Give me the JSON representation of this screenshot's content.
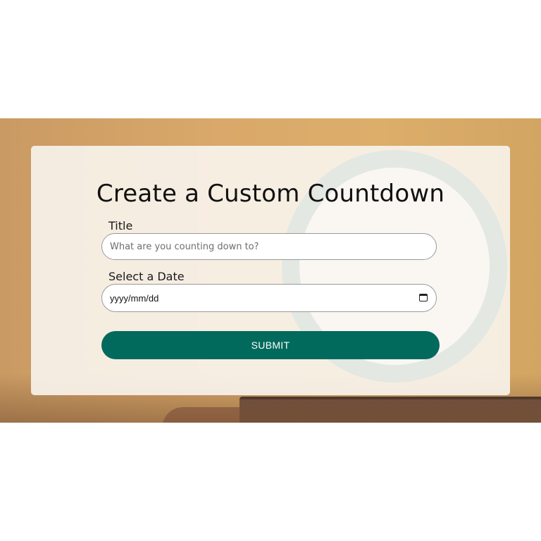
{
  "form": {
    "heading": "Create a Custom Countdown",
    "title_label": "Title",
    "title_placeholder": "What are you counting down to?",
    "date_label": "Select a Date",
    "date_value": "yyyy/mm/dd",
    "submit_label": "SUBMIT"
  },
  "colors": {
    "accent": "#016a5c",
    "background_tone": "#d9a86a"
  },
  "icons": {
    "date_picker": "calendar-icon"
  }
}
